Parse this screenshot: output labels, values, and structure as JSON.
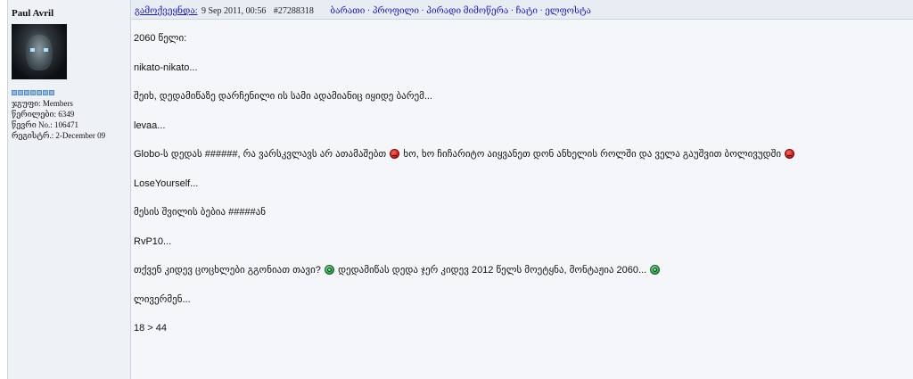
{
  "author": {
    "name": "Paul Avril",
    "group": "ჯგუფი: Members",
    "posts": "წერილები: 6349",
    "member_no": "წევრი No.: 106471",
    "registered": "რეგისტრ.: 2-December 09"
  },
  "header": {
    "posted_label": "გამოქვეყნდა:",
    "date": "9 Sep 2011, 00:56",
    "post_id": "#27288318",
    "links": "ბარათი · პროფილი · პირადი მიმოწერა · ჩატი · ელფოსტა"
  },
  "lines": [
    {
      "text": "2060 წელი:"
    },
    {
      "text": "nikato-nikato..."
    },
    {
      "text": "შეიხ, დედამიწაზე დარჩენილი ის სამი ადამიანიც იყიდე ბარემ..."
    },
    {
      "text": "levaa..."
    },
    {
      "text_a": "Globo-ს დედას ######, რა ვარსკვლავს არ ათამაშებთ",
      "text_b": "ხო, ხო ჩიჩარიტო აიყვანეთ დონ ანხელის როლში და ველა გაუშვით ბოლივუდში"
    },
    {
      "text": "LoseYourself..."
    },
    {
      "text": "მესის შვილის ბებია #####ან"
    },
    {
      "text": "RvP10..."
    },
    {
      "text_a": "თქვენ კიდევ ცოცხლები გგონიათ თავი?",
      "text_b": "დედამიწას დედა ჯერ კიდევ 2012 წელს მოეტყნა, მონტაჟია 2060..."
    },
    {
      "text": "ლივერმენ..."
    },
    {
      "text": "18 > 44"
    }
  ],
  "icons": {
    "angry": "angry-smiley-icon",
    "green": "green-smiley-icon"
  },
  "colors": {
    "link": "#1a1aa6",
    "sidebar_bg": "#eef1f6",
    "body_bg": "#f4f6f9"
  }
}
